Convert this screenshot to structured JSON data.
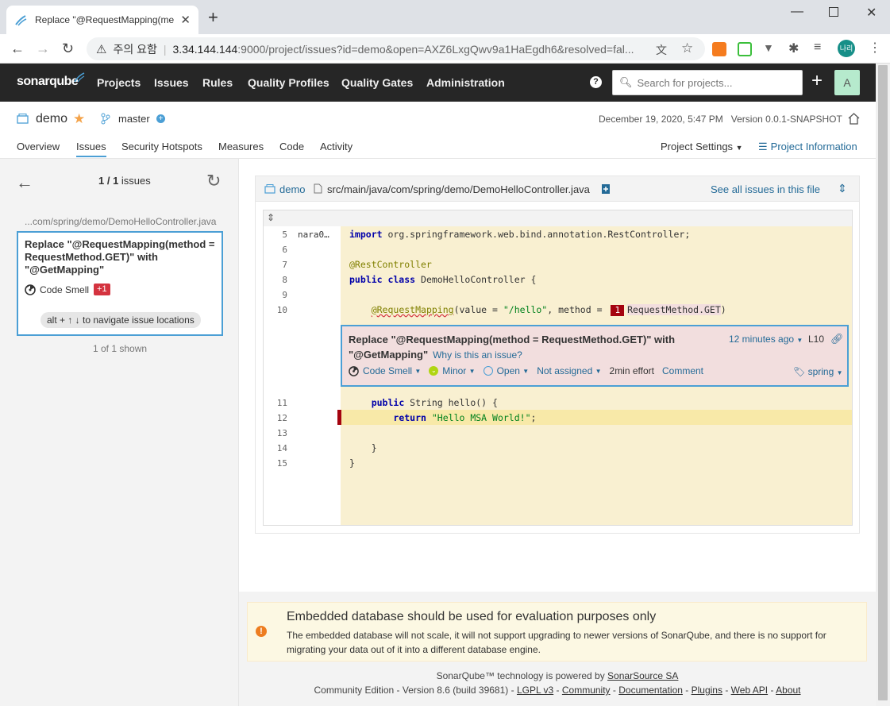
{
  "browser": {
    "tab_title": "Replace \"@RequestMapping(me",
    "url_security": "주의 요함",
    "url_host": "3.34.144.144",
    "url_path": ":9000/project/issues?id=demo&open=AXZ6LxgQwv9a1HaEgdh6&resolved=fal...",
    "profile_label": "나리"
  },
  "nav": {
    "logo": "sonarqube",
    "links": [
      "Projects",
      "Issues",
      "Rules",
      "Quality Profiles",
      "Quality Gates",
      "Administration"
    ],
    "search_placeholder": "Search for projects...",
    "avatar": "A"
  },
  "project": {
    "name": "demo",
    "branch": "master",
    "date": "December 19, 2020, 5:47 PM",
    "version": "Version 0.0.1-SNAPSHOT",
    "tabs": [
      "Overview",
      "Issues",
      "Security Hotspots",
      "Measures",
      "Code",
      "Activity"
    ],
    "settings": "Project Settings",
    "info": "Project Information"
  },
  "issues_panel": {
    "count_bold": "1 / 1",
    "count_label": "issues",
    "file_path": "...com/spring/demo/DemoHelloController.java",
    "issue_message": "Replace \"@RequestMapping(method = RequestMethod.GET)\" with \"@GetMapping\"",
    "issue_type": "Code Smell",
    "flow_badge": "+1",
    "nav_hint": "alt + ↑ ↓ to navigate issue locations",
    "shown": "1 of 1 shown"
  },
  "viewer": {
    "project": "demo",
    "file": "src/main/java/com/spring/demo/DemoHelloController.java",
    "see_all": "See all issues in this file",
    "author": "nara0…",
    "lines": [
      {
        "n": "5",
        "text": "import org.springframework.web.bind.annotation.RestController;"
      },
      {
        "n": "6",
        "text": ""
      },
      {
        "n": "7",
        "text": "@RestController"
      },
      {
        "n": "8",
        "text": "public class DemoHelloController {"
      },
      {
        "n": "9",
        "text": ""
      },
      {
        "n": "10",
        "text": "    @RequestMapping(value = \"/hello\", method = RequestMethod.GET)"
      },
      {
        "n": "11",
        "text": "    public String hello() {"
      },
      {
        "n": "12",
        "text": "        return \"Hello MSA World!\";"
      },
      {
        "n": "13",
        "text": ""
      },
      {
        "n": "14",
        "text": "    }"
      },
      {
        "n": "15",
        "text": "}"
      }
    ],
    "location_badge": "1",
    "issue": {
      "message": "Replace \"@RequestMapping(method = RequestMethod.GET)\" with \"@GetMapping\"",
      "why": "Why is this an issue?",
      "time": "12 minutes ago",
      "line": "L10",
      "type": "Code Smell",
      "severity": "Minor",
      "status": "Open",
      "assignee": "Not assigned",
      "effort": "2min effort",
      "comment": "Comment",
      "tag": "spring"
    }
  },
  "banner": {
    "title": "Embedded database should be used for evaluation purposes only",
    "text": "The embedded database will not scale, it will not support upgrading to newer versions of SonarQube, and there is no support for migrating your data out of it into a different database engine."
  },
  "footer": {
    "line1_prefix": "SonarQube™ technology is powered by",
    "line1_link": "SonarSource SA",
    "line2_prefix": "Community Edition - Version 8.6 (build 39681) -",
    "links": [
      "LGPL v3",
      "Community",
      "Documentation",
      "Plugins",
      "Web API",
      "About"
    ]
  },
  "colors": {
    "accent": "#4b9fd5",
    "nav_bg": "#262626",
    "link": "#236a97",
    "issue_bg": "#f2dede",
    "code_bg": "#f9f0d1"
  }
}
